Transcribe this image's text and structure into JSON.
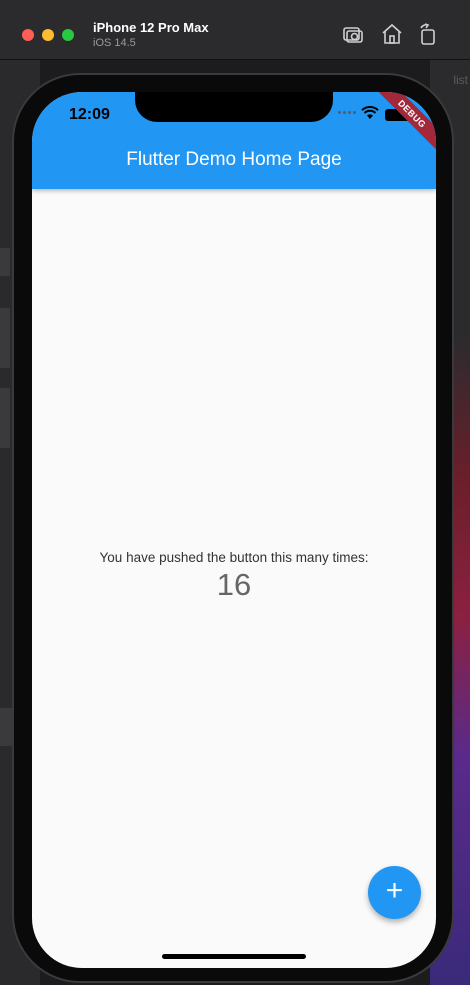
{
  "simulator": {
    "device_name": "iPhone 12 Pro Max",
    "os_version": "iOS 14.5",
    "toolbar": {
      "screenshot_icon": "camera-icon",
      "home_icon": "home-icon",
      "rotate_icon": "rotate-icon"
    }
  },
  "background": {
    "right_text": "list"
  },
  "status_bar": {
    "time": "12:09",
    "debug_label": "DEBUG"
  },
  "app": {
    "title": "Flutter Demo Home Page",
    "message": "You have pushed the button this many times:",
    "counter": "16",
    "fab_label": "+",
    "primary_color": "#2196f3"
  }
}
